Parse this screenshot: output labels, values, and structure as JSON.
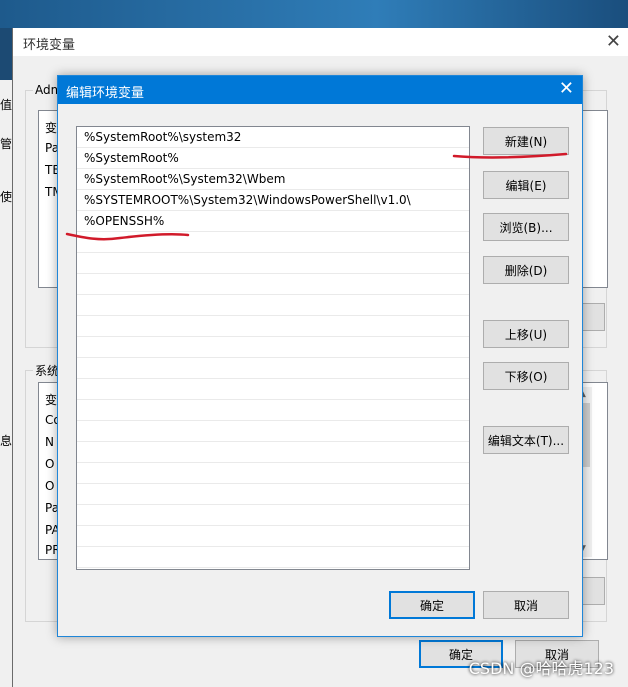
{
  "background_window": {
    "title": "环境变量",
    "close_glyph": "✕",
    "user_group_label": "Adm",
    "user_list": [
      "变",
      "Pa",
      "TE",
      "TM"
    ],
    "system_group_label": "系统",
    "system_list": [
      "变",
      "Co",
      "N",
      "O",
      "O",
      "Pa",
      "PA",
      "PR"
    ],
    "left_clip": [
      "值",
      "管",
      "使",
      "息"
    ],
    "ok_label": "确定",
    "cancel_label": "取消"
  },
  "dialog": {
    "title": "编辑环境变量",
    "close_glyph": "✕",
    "paths": [
      "%SystemRoot%\\system32",
      "%SystemRoot%",
      "%SystemRoot%\\System32\\Wbem",
      "%SYSTEMROOT%\\System32\\WindowsPowerShell\\v1.0\\",
      "%OPENSSH%",
      "",
      "",
      "",
      "",
      "",
      "",
      "",
      "",
      "",
      "",
      "",
      "",
      "",
      "",
      "",
      ""
    ],
    "buttons": {
      "new": "新建(N)",
      "edit": "编辑(E)",
      "browse": "浏览(B)...",
      "delete": "删除(D)",
      "move_up": "上移(U)",
      "move_down": "下移(O)",
      "edit_text": "编辑文本(T)...",
      "ok": "确定",
      "cancel": "取消"
    }
  },
  "watermark": "CSDN @哈哈虎123",
  "colors": {
    "accent": "#0078d7",
    "annotation": "#d11a2a"
  }
}
